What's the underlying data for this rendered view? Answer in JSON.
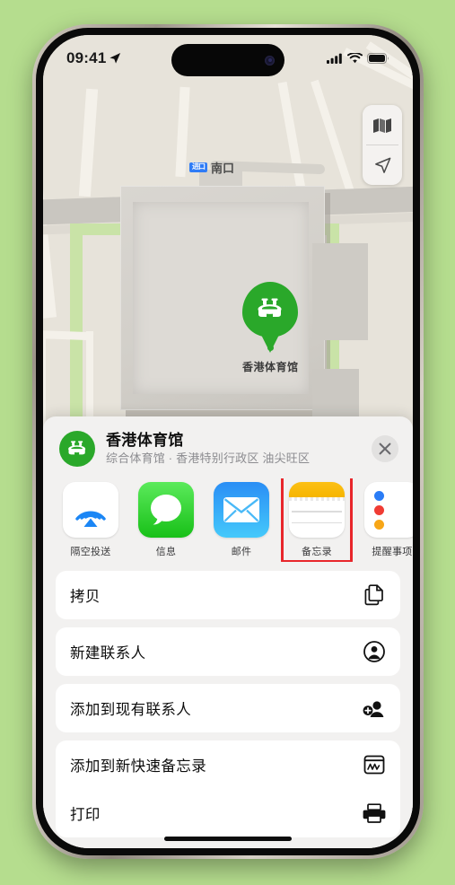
{
  "status_bar": {
    "time": "09:41",
    "location_arrow_icon": "location-arrow-icon",
    "cellular_icon": "cellular-bars-icon",
    "wifi_icon": "wifi-icon",
    "battery_icon": "battery-full-icon"
  },
  "map": {
    "label_nankou": "南口",
    "metro_badge": "进口",
    "pin_label": "香港体育馆",
    "pin_icon": "stadium-icon",
    "controls": {
      "layers_icon": "folded-map-icon",
      "locate_icon": "navigation-arrow-icon"
    }
  },
  "share_sheet": {
    "title": "香港体育馆",
    "subtitle": "综合体育馆 · 香港特别行政区 油尖旺区",
    "place_icon": "stadium-icon",
    "close_icon": "close-x-icon",
    "apps": [
      {
        "label": "隔空投送",
        "icon": "airdrop-icon",
        "highlighted": false
      },
      {
        "label": "信息",
        "icon": "messages-icon",
        "highlighted": false
      },
      {
        "label": "邮件",
        "icon": "mail-icon",
        "highlighted": false
      },
      {
        "label": "备忘录",
        "icon": "notes-icon",
        "highlighted": true
      },
      {
        "label": "提醒事项",
        "icon": "reminders-icon",
        "highlighted": false
      }
    ],
    "actions": [
      {
        "label": "拷贝",
        "icon": "copy-icon"
      },
      {
        "label": "新建联系人",
        "icon": "new-contact-icon"
      },
      {
        "label": "添加到现有联系人",
        "icon": "add-to-contact-icon"
      },
      {
        "label": "添加到新快速备忘录",
        "icon": "quick-note-icon"
      },
      {
        "label": "打印",
        "icon": "printer-icon"
      }
    ]
  },
  "colors": {
    "background": "#b5dd8e",
    "accent_green": "#2aa82a",
    "highlight_red": "#e8262b",
    "metro_blue": "#2f7cf6"
  }
}
